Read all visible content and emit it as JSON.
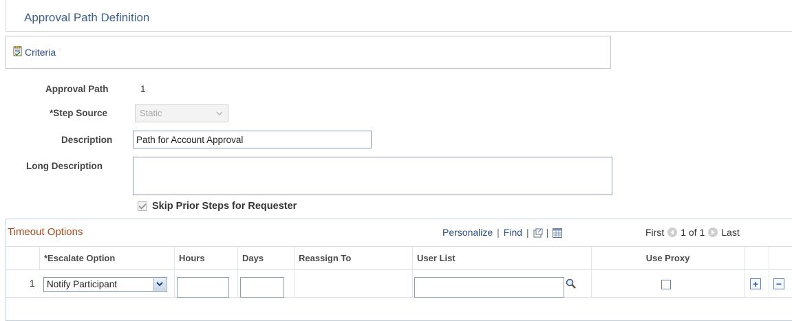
{
  "page": {
    "title": "Approval Path Definition"
  },
  "criteria": {
    "label": "Criteria"
  },
  "form": {
    "approval_path_label": "Approval Path",
    "approval_path_value": "1",
    "step_source_label": "*Step Source",
    "step_source_value": "Static",
    "description_label": "Description",
    "description_value": "Path for Account Approval",
    "long_description_label": "Long Description",
    "long_description_value": "",
    "skip_prior_label": "Skip Prior Steps for Requester",
    "skip_prior_checked": true
  },
  "grid": {
    "title": "Timeout Options",
    "personalize": "Personalize",
    "find": "Find",
    "first": "First",
    "count": "1 of 1",
    "last": "Last",
    "columns": [
      "*Escalate Option",
      "Hours",
      "Days",
      "Reassign To",
      "User List",
      "Use Proxy"
    ],
    "rows": [
      {
        "num": "1",
        "escalate_option": "Notify Participant",
        "hours": "",
        "days": "",
        "reassign_to": "",
        "user_list": "",
        "use_proxy": false
      }
    ]
  },
  "colors": {
    "title": "#3d5f8a",
    "link": "#2b4e84",
    "grid_title": "#a04a1c"
  }
}
